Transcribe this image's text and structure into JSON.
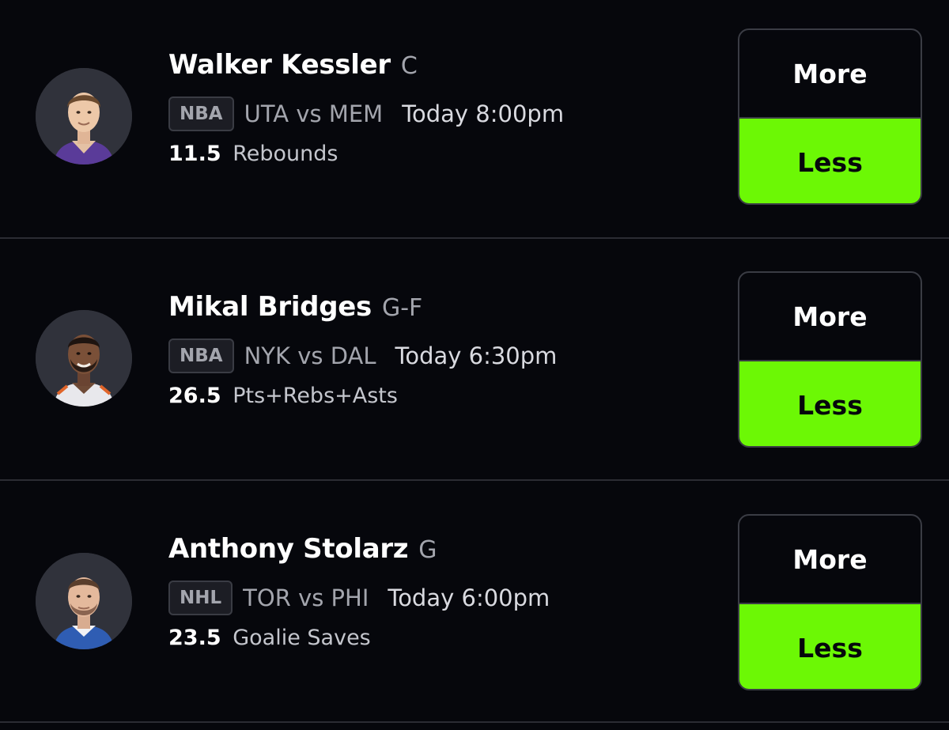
{
  "colors": {
    "background": "#06070c",
    "accent_selected": "#6cf805",
    "divider": "#2b2c33"
  },
  "picks": [
    {
      "player_name": "Walker Kessler",
      "position": "C",
      "league": "NBA",
      "matchup": "UTA vs MEM",
      "game_time": "Today 8:00pm",
      "line_value": "11.5",
      "stat_type": "Rebounds",
      "more_label": "More",
      "less_label": "Less",
      "selected": "Less",
      "jersey_color": "#5a3b99"
    },
    {
      "player_name": "Mikal Bridges",
      "position": "G-F",
      "league": "NBA",
      "matchup": "NYK vs DAL",
      "game_time": "Today 6:30pm",
      "line_value": "26.5",
      "stat_type": "Pts+Rebs+Asts",
      "more_label": "More",
      "less_label": "Less",
      "selected": "Less",
      "jersey_color": "#e8e8ec"
    },
    {
      "player_name": "Anthony Stolarz",
      "position": "G",
      "league": "NHL",
      "matchup": "TOR vs PHI",
      "game_time": "Today 6:00pm",
      "line_value": "23.5",
      "stat_type": "Goalie Saves",
      "more_label": "More",
      "less_label": "Less",
      "selected": "Less",
      "jersey_color": "#2f5db3"
    }
  ]
}
